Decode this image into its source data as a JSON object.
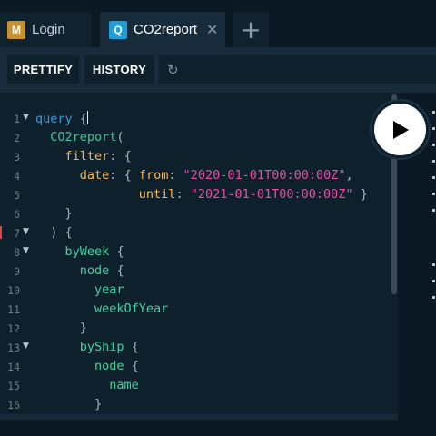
{
  "tabs": [
    {
      "badge": "M",
      "badge_color": "#c8912f",
      "label": "Login"
    },
    {
      "badge": "Q",
      "badge_color": "#1e9ed6",
      "label": "CO2report",
      "close": "✕"
    }
  ],
  "add_tab": "+",
  "toolbar": {
    "prettify_label": "PRETTIFY",
    "history_label": "HISTORY",
    "reload_icon": "↻"
  },
  "editor": {
    "lines": [
      {
        "n": "1",
        "fold": "▼"
      },
      {
        "n": "2",
        "fold": ""
      },
      {
        "n": "3",
        "fold": ""
      },
      {
        "n": "4",
        "fold": ""
      },
      {
        "n": "5",
        "fold": ""
      },
      {
        "n": "6",
        "fold": ""
      },
      {
        "n": "7",
        "fold": "▼"
      },
      {
        "n": "8",
        "fold": "▼"
      },
      {
        "n": "9",
        "fold": ""
      },
      {
        "n": "10",
        "fold": ""
      },
      {
        "n": "11",
        "fold": ""
      },
      {
        "n": "12",
        "fold": ""
      },
      {
        "n": "13",
        "fold": "▼"
      },
      {
        "n": "14",
        "fold": ""
      },
      {
        "n": "15",
        "fold": ""
      },
      {
        "n": "16",
        "fold": ""
      }
    ],
    "tokens": {
      "query_kw": "query",
      "open_brace": "{",
      "co2report": "CO2report",
      "open_paren": "(",
      "filter": "filter",
      "colon": ":",
      "date": "date",
      "from": "from",
      "from_val": "\"2020-01-01T00:00:00Z\"",
      "comma": ",",
      "until": "until",
      "until_val": "\"2021-01-01T00:00:00Z\"",
      "close_brace": "}",
      "close_paren": ")",
      "byWeek": "byWeek",
      "node": "node",
      "year": "year",
      "weekOfYear": "weekOfYear",
      "byShip": "byShip",
      "name": "name"
    }
  },
  "run_button_icon": "play-icon"
}
